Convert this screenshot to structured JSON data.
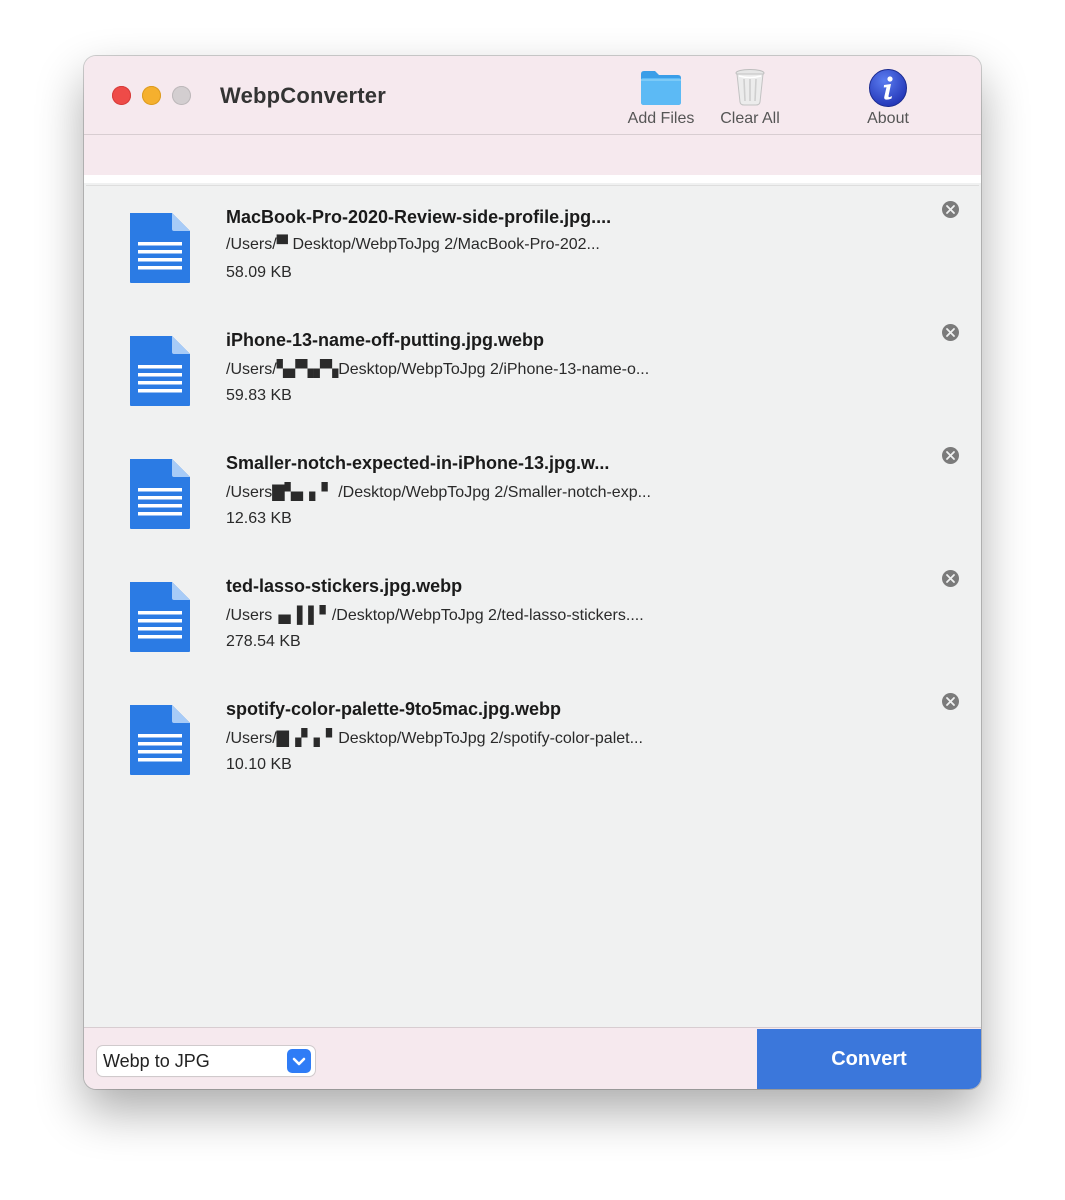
{
  "window": {
    "title": "WebpConverter"
  },
  "toolbar": {
    "add_files_label": "Add Files",
    "clear_all_label": "Clear All",
    "about_label": "About"
  },
  "files": [
    {
      "name": "MacBook-Pro-2020-Review-side-profile.jpg....",
      "path": "/Users/▀      Desktop/WebpToJpg 2/MacBook-Pro-202...",
      "size": "58.09 KB"
    },
    {
      "name": "iPhone-13-name-off-putting.jpg.webp",
      "path": "/Users/▚▞▚▞▚Desktop/WebpToJpg 2/iPhone-13-name-o...",
      "size": "59.83 KB"
    },
    {
      "name": "Smaller-notch-expected-in-iPhone-13.jpg.w...",
      "path": "/Users▇▚▖▖▘ /Desktop/WebpToJpg 2/Smaller-notch-exp...",
      "size": "12.63 KB"
    },
    {
      "name": "ted-lasso-stickers.jpg.webp",
      "path": "/Users▗▖▌▌▘/Desktop/WebpToJpg 2/ted-lasso-stickers....",
      "size": "278.54 KB"
    },
    {
      "name": "spotify-color-palette-9to5mac.jpg.webp",
      "path": "/Users/▇▗▘▖▘Desktop/WebpToJpg 2/spotify-color-palet...",
      "size": "10.10 KB"
    }
  ],
  "footer": {
    "format_value": "Webp to JPG",
    "convert_label": "Convert"
  },
  "icons": {
    "add_files": "folder-icon",
    "clear_all": "trash-icon",
    "about": "info-icon",
    "file": "document-icon",
    "remove": "close-circle-icon",
    "select": "chevron-down-icon"
  },
  "colors": {
    "titlebar_bg": "#f6e9ee",
    "list_bg": "#f0f1f1",
    "convert_bg": "#3b77db",
    "document_blue": "#2b7be4",
    "close_light": "#ee4b48",
    "minimize_light": "#f5b02e",
    "zoom_light": "#d3ced0"
  }
}
